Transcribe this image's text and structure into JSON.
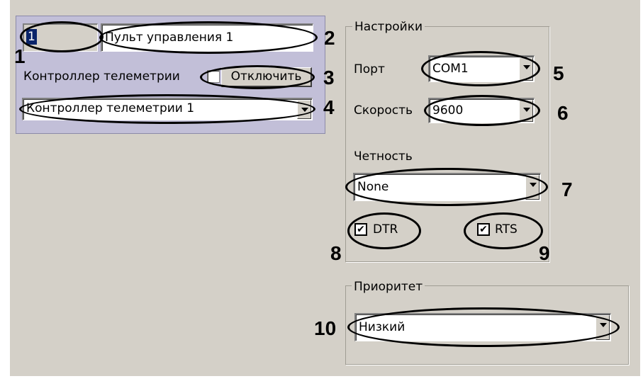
{
  "device": {
    "id_value": "1",
    "name_value": "Пульт управления 1",
    "telemetry_label": "Контроллер телеметрии",
    "disable_button": "Отключить",
    "telemetry_controller": "Контроллер телеметрии 1"
  },
  "settings": {
    "group_title": "Настройки",
    "port_label": "Порт",
    "port_value": "COM1",
    "speed_label": "Скорость",
    "speed_value": "9600",
    "parity_label": "Четность",
    "parity_value": "None",
    "dtr_label": "DTR",
    "dtr_checked": true,
    "rts_label": "RTS",
    "rts_checked": true,
    "check_mark": "✔"
  },
  "priority": {
    "group_title": "Приоритет",
    "value": "Низкий"
  },
  "callouts": [
    "1",
    "2",
    "3",
    "4",
    "5",
    "6",
    "7",
    "8",
    "9",
    "10"
  ]
}
